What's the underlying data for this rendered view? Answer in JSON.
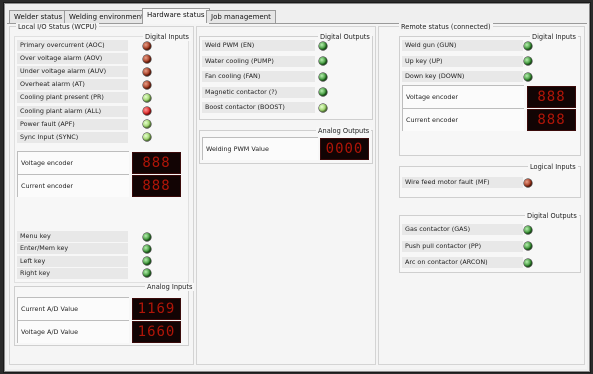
{
  "tabs": [
    {
      "label": "Welder status"
    },
    {
      "label": "Welding environment"
    },
    {
      "label": "Hardware status"
    },
    {
      "label": "Job management"
    }
  ],
  "local": {
    "title": "Local I/O Status (WCPU)",
    "digital_inputs_title": "Digital Inputs",
    "digital_inputs": [
      {
        "label": "Primary overcurrent (AOC)",
        "led": "red"
      },
      {
        "label": "Over voltage alarm (AOV)",
        "led": "red"
      },
      {
        "label": "Under voltage alarm (AUV)",
        "led": "red"
      },
      {
        "label": "Overheat alarm (AT)",
        "led": "red"
      },
      {
        "label": "Cooling plant present (PR)",
        "led": "lgreen"
      },
      {
        "label": "Cooling plant alarm (ALL)",
        "led": "bred"
      },
      {
        "label": "Power fault (APF)",
        "led": "lgreen"
      },
      {
        "label": "Sync Input (SYNC)",
        "led": "lgreen"
      }
    ],
    "encoders": [
      {
        "label": "Voltage encoder",
        "value": "888"
      },
      {
        "label": "Current encoder",
        "value": "888"
      }
    ],
    "keys": [
      {
        "label": "Menu key",
        "led": "green"
      },
      {
        "label": "Enter/Mem key",
        "led": "green"
      },
      {
        "label": "Left key",
        "led": "green"
      },
      {
        "label": "Right key",
        "led": "green"
      }
    ],
    "analog_inputs_title": "Analog Inputs",
    "analog_inputs": [
      {
        "label": "Current A/D Value",
        "value": "1169"
      },
      {
        "label": "Voltage A/D Value",
        "value": "1660"
      }
    ]
  },
  "middle": {
    "digital_outputs_title": "Digital Outputs",
    "digital_outputs": [
      {
        "label": "Weld PWM (EN)",
        "led": "green"
      },
      {
        "label": "Water cooling (PUMP)",
        "led": "green"
      },
      {
        "label": "Fan cooling (FAN)",
        "led": "green"
      },
      {
        "label": "Magnetic contactor (?)",
        "led": "green"
      },
      {
        "label": "Boost contactor (BOOST)",
        "led": "lgreen"
      }
    ],
    "analog_outputs_title": "Analog Outputs",
    "analog_outputs": [
      {
        "label": "Welding PWM Value",
        "value": "0000"
      }
    ]
  },
  "remote": {
    "title": "Remote status (connected)",
    "digital_inputs_title": "Digital Inputs",
    "digital_inputs": [
      {
        "label": "Weld gun (GUN)",
        "led": "green"
      },
      {
        "label": "Up key (UP)",
        "led": "green"
      },
      {
        "label": "Down key (DOWN)",
        "led": "green"
      }
    ],
    "encoders": [
      {
        "label": "Voltage encoder",
        "value": "888"
      },
      {
        "label": "Current encoder",
        "value": "888"
      }
    ],
    "logical_inputs_title": "Logical Inputs",
    "logical_inputs": [
      {
        "label": "Wire feed motor fault (MF)",
        "led": "red"
      }
    ],
    "digital_outputs_title": "Digital Outputs",
    "digital_outputs": [
      {
        "label": "Gas contactor (GAS)",
        "led": "green"
      },
      {
        "label": "Push pull contactor (PP)",
        "led": "green"
      },
      {
        "label": "Arc on contactor (ARCON)",
        "led": "green"
      }
    ]
  }
}
